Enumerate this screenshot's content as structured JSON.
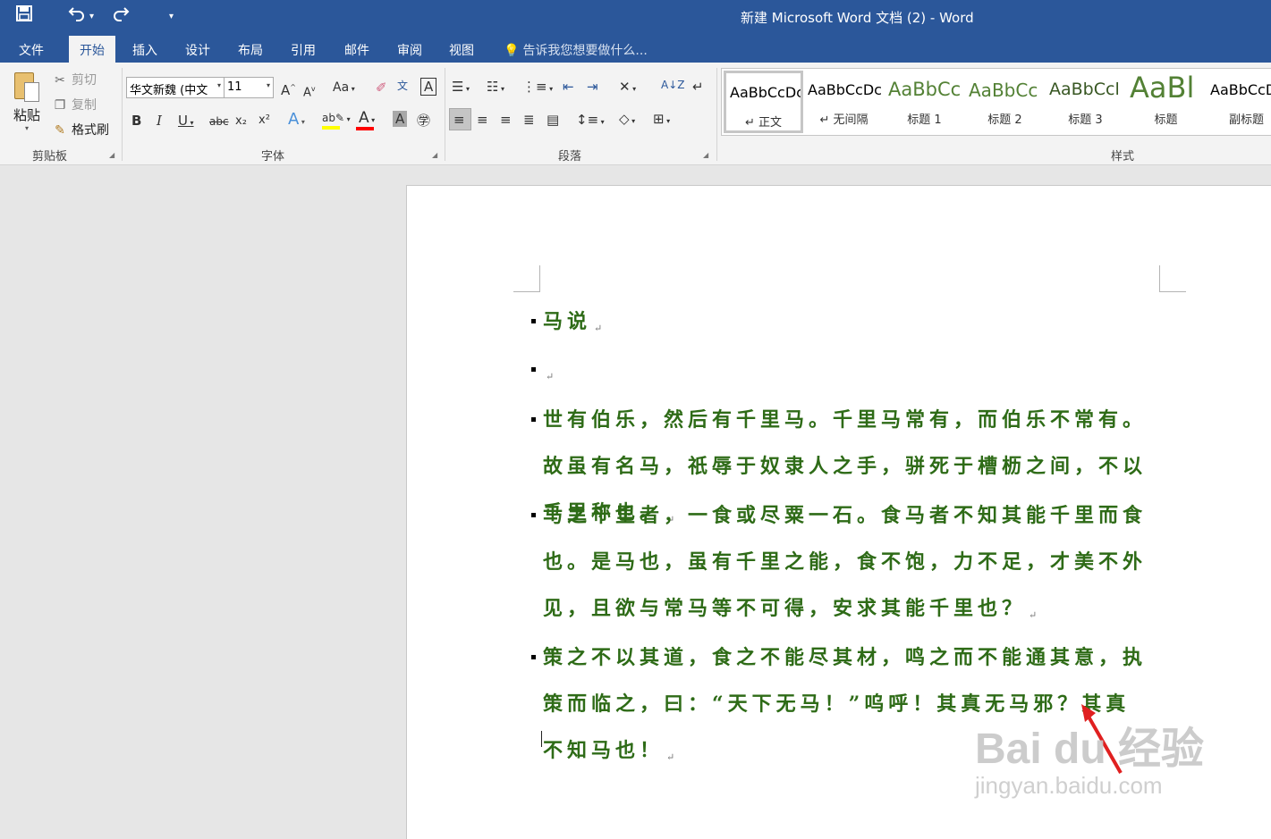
{
  "window": {
    "title": "新建 Microsoft Word 文档 (2) - Word"
  },
  "quick_access": {
    "save_icon": "save-icon",
    "undo_icon": "undo-icon",
    "redo_icon": "redo-icon",
    "customize_icon": "customize-qat-icon"
  },
  "tabs": [
    {
      "label": "文件"
    },
    {
      "label": "开始",
      "active": true
    },
    {
      "label": "插入"
    },
    {
      "label": "设计"
    },
    {
      "label": "布局"
    },
    {
      "label": "引用"
    },
    {
      "label": "邮件"
    },
    {
      "label": "审阅"
    },
    {
      "label": "视图"
    }
  ],
  "tell_me": "告诉我您想要做什么...",
  "clipboard": {
    "paste_label": "粘贴",
    "cut_label": "剪切",
    "copy_label": "复制",
    "format_painter_label": "格式刷",
    "group_label": "剪贴板"
  },
  "font": {
    "name": "华文新魏 (中文",
    "size": "11",
    "group_label": "字体",
    "grow_glyph": "A",
    "shrink_glyph": "A",
    "case_glyph": "Aa",
    "bold_glyph": "B",
    "italic_glyph": "I",
    "underline_glyph": "U",
    "strike_glyph": "abc",
    "subscript_glyph": "x₂",
    "superscript_glyph": "x²",
    "font_color_glyph": "A",
    "shade_glyph": "A",
    "phonetic_glyph": "文",
    "border_glyph": "A",
    "highlight_color": "#ffff00",
    "font_color": "#ff0000"
  },
  "paragraph": {
    "group_label": "段落"
  },
  "styles": {
    "group_label": "样式",
    "items": [
      {
        "sample": "AaBbCcDc",
        "name": "↵ 正文",
        "color": "#000000",
        "size": 16
      },
      {
        "sample": "AaBbCcDc",
        "name": "↵ 无间隔",
        "color": "#000000",
        "size": 16
      },
      {
        "sample": "AaBbCc",
        "name": "标题 1",
        "color": "#538135",
        "size": 22
      },
      {
        "sample": "AaBbCc",
        "name": "标题 2",
        "color": "#538135",
        "size": 21
      },
      {
        "sample": "AaBbCcl",
        "name": "标题 3",
        "color": "#385723",
        "size": 20
      },
      {
        "sample": "AaBl",
        "name": "标题",
        "color": "#538135",
        "size": 34
      },
      {
        "sample": "AaBbCcD",
        "name": "副标题",
        "color": "#000000",
        "size": 16
      }
    ]
  },
  "document": {
    "text_color": "#2e6b17",
    "paragraphs": [
      "马说",
      "",
      "世有伯乐，然后有千里马。千里马常有，而伯乐不常有。故虽有名马，祇辱于奴隶人之手，骈死于槽枥之间，不以千里称也。",
      "马之千里者，一食或尽粟一石。食马者不知其能千里而食也。是马也，虽有千里之能，食不饱，力不足，才美不外见，且欲与常马等不可得，安求其能千里也？",
      "策之不以其道，食之不能尽其材，鸣之而不能通其意，执策而临之，曰：“天下无马！”呜呼！其真无马邪？其真不知马也！"
    ],
    "para_mark": "↵"
  },
  "watermark": {
    "brand": "Bai du 经验",
    "url": "jingyan.baidu.com"
  }
}
